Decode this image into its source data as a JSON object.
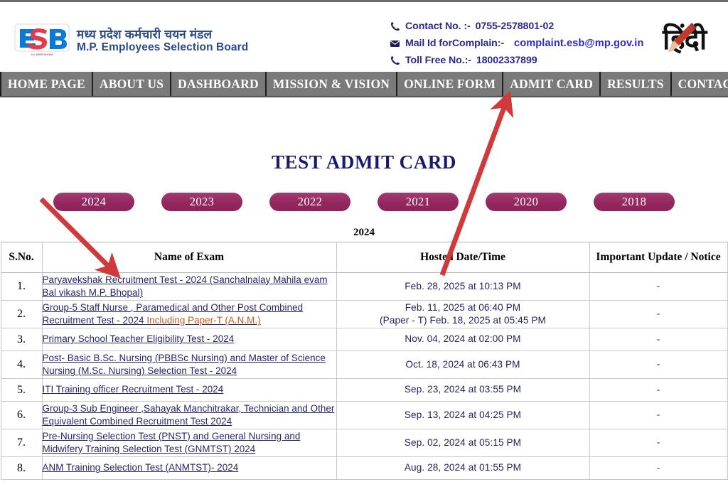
{
  "site": {
    "logo_alt": "ESB",
    "org_name_hi": "मध्य प्रदेश कर्मचारी चयन मंडल",
    "org_name_en": "M.P. Employees Selection Board",
    "language_toggle": "हिंदी"
  },
  "contact": {
    "phone_label": "Contact No. :-",
    "phone_value": "0755-2578801-02",
    "mail_label": "Mail Id forComplain:-",
    "mail_value": "complaint.esb@mp.gov.in",
    "tollfree_label": "Toll Free No.:-",
    "tollfree_value": "18002337899",
    "phone_icon": "phone-icon",
    "mail_icon": "mail-icon"
  },
  "nav": {
    "items": [
      "HOME PAGE",
      "ABOUT US",
      "DASHBOARD",
      "MISSION & VISION",
      "ONLINE FORM",
      "ADMIT CARD",
      "RESULTS",
      "CONTACT US"
    ],
    "active": "ADMIT CARD"
  },
  "main": {
    "title": "TEST ADMIT CARD",
    "years": [
      "2024",
      "2023",
      "2022",
      "2021",
      "2020",
      "2018"
    ],
    "selected_year": "2024",
    "section_label": "2024"
  },
  "table": {
    "headers": [
      "S.No.",
      "Name of Exam",
      "Hosted Date/Time",
      "Important Update / Notice"
    ],
    "rows": [
      {
        "sno": "1.",
        "name": "Paryavekshak Recruitment Test - 2024 (Sanchalnalay Mahila evam Bal vikash M.P. Bhopal)",
        "name_extra": "",
        "date": "Feb. 28,  2025 at 10:13 PM",
        "date2": "",
        "note": "-"
      },
      {
        "sno": "2.",
        "name": "Group-5 Staff Nurse , Paramedical and Other Post Combined Recruitment Test - 2024 ",
        "name_extra": "Including Paper-T (A.N.M.)",
        "date": "Feb. 11,  2025 at 06:40 PM",
        "date2": "(Paper - T) Feb. 18, 2025 at 05:45 PM",
        "note": "-"
      },
      {
        "sno": "3.",
        "name": "Primary School Teacher Eligibility Test - 2024",
        "name_extra": "",
        "date": "Nov. 04,  2024 at 02:00 PM",
        "date2": "",
        "note": "-"
      },
      {
        "sno": "4.",
        "name": "Post- Basic B.Sc. Nursing (PBBSc Nursing) and Master of Science Nursing (M.Sc. Nursing) Selection Test - 2024",
        "name_extra": "",
        "date": "Oct. 18,  2024 at 06:43 PM",
        "date2": "",
        "note": "-"
      },
      {
        "sno": "5.",
        "name": "ITI Training officer Recruitment Test - 2024",
        "name_extra": "",
        "date": "Sep. 23,  2024 at 03:55 PM",
        "date2": "",
        "note": "-"
      },
      {
        "sno": "6.",
        "name": "Group-3 Sub Engineer ,Sahayak Manchitrakar, Technician and Other Equivalent Combined Recruitment Test 2024",
        "name_extra": "",
        "date": "Sep. 13,  2024 at 04:25 PM",
        "date2": "",
        "note": "-"
      },
      {
        "sno": "7.",
        "name": "Pre-Nursing Selection Test (PNST) and General Nursing and Midwifery Training Selection Test (GNMTST) 2024",
        "name_extra": "",
        "date": "Sep. 02,  2024 at 05:15 PM",
        "date2": "",
        "note": "-"
      },
      {
        "sno": "8.",
        "name": "ANM Training Selection Test (ANMTST)- 2024",
        "name_extra": "",
        "date": "Aug. 28,  2024 at 01:55 PM",
        "date2": "",
        "note": "-"
      }
    ]
  },
  "colors": {
    "nav_bg": "#7a7a7a",
    "pill": "#95275f",
    "title": "#1b1b6e",
    "link": "#24246b",
    "highlight": "#c4571d",
    "annotation_arrow": "#d03a3a"
  },
  "annotations": {
    "arrow_to_exam_link": "arrow pointing to first exam name link",
    "arrow_to_admit_card": "arrow pointing to ADMIT CARD nav item"
  }
}
